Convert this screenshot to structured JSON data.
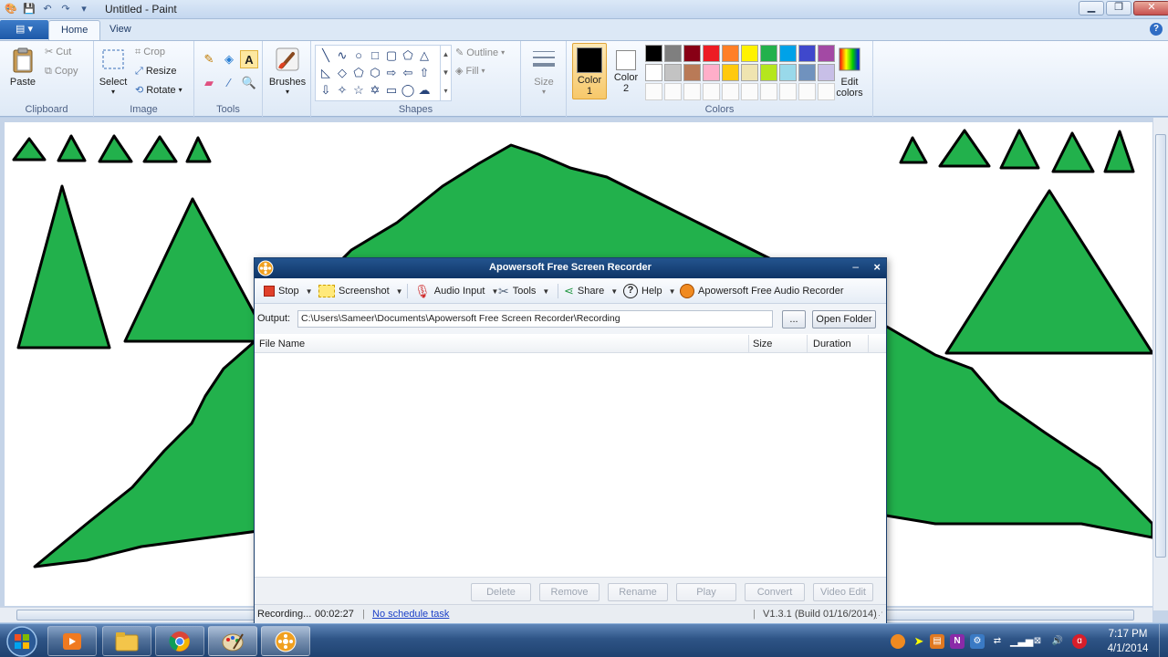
{
  "paint": {
    "title": "Untitled - Paint",
    "tabs": [
      "Home",
      "View"
    ],
    "clipboard": {
      "paste": "Paste",
      "cut": "Cut",
      "copy": "Copy",
      "label": "Clipboard"
    },
    "image": {
      "select": "Select",
      "crop": "Crop",
      "resize": "Resize",
      "rotate": "Rotate",
      "label": "Image"
    },
    "tools": {
      "label": "Tools",
      "brushes": "Brushes"
    },
    "shapes": {
      "outline": "Outline",
      "fill": "Fill",
      "label": "Shapes"
    },
    "size": "Size",
    "color1": {
      "label": "Color",
      "num": "1",
      "value": "#000000"
    },
    "color2": {
      "label": "Color",
      "num": "2",
      "value": "#ffffff"
    },
    "colors_label": "Colors",
    "edit_colors": [
      "Edit",
      "colors"
    ],
    "palette_row1": [
      "#000000",
      "#7f7f7f",
      "#880015",
      "#ed1c24",
      "#ff7f27",
      "#fff200",
      "#22b14c",
      "#00a2e8",
      "#3f48cc",
      "#a349a4"
    ],
    "palette_row2": [
      "#ffffff",
      "#c3c3c3",
      "#b97a57",
      "#ffaec9",
      "#ffc90e",
      "#efe4b0",
      "#b5e61d",
      "#99d9ea",
      "#7092be",
      "#c8bfe7"
    ],
    "drawing_fill": "#22b14c"
  },
  "recorder": {
    "title": "Apowersoft Free Screen Recorder",
    "toolbar": {
      "stop": "Stop",
      "screenshot": "Screenshot",
      "audio_input": "Audio Input",
      "tools": "Tools",
      "share": "Share",
      "help": "Help",
      "audio_recorder": "Apowersoft Free Audio Recorder"
    },
    "output_label": "Output:",
    "output_path": "C:\\Users\\Sameer\\Documents\\Apowersoft Free Screen Recorder\\Recording",
    "browse": "...",
    "open_folder": "Open Folder",
    "columns": {
      "file_name": "File Name",
      "size": "Size",
      "duration": "Duration"
    },
    "actions": [
      "Delete",
      "Remove",
      "Rename",
      "Play",
      "Convert",
      "Video Edit"
    ],
    "status": {
      "recording": "Recording...",
      "time": "00:02:27",
      "schedule": "No schedule task",
      "version": "V1.3.1 (Build 01/16/2014)"
    }
  },
  "taskbar": {
    "clock_time": "7:17 PM",
    "clock_date": "4/1/2014"
  }
}
